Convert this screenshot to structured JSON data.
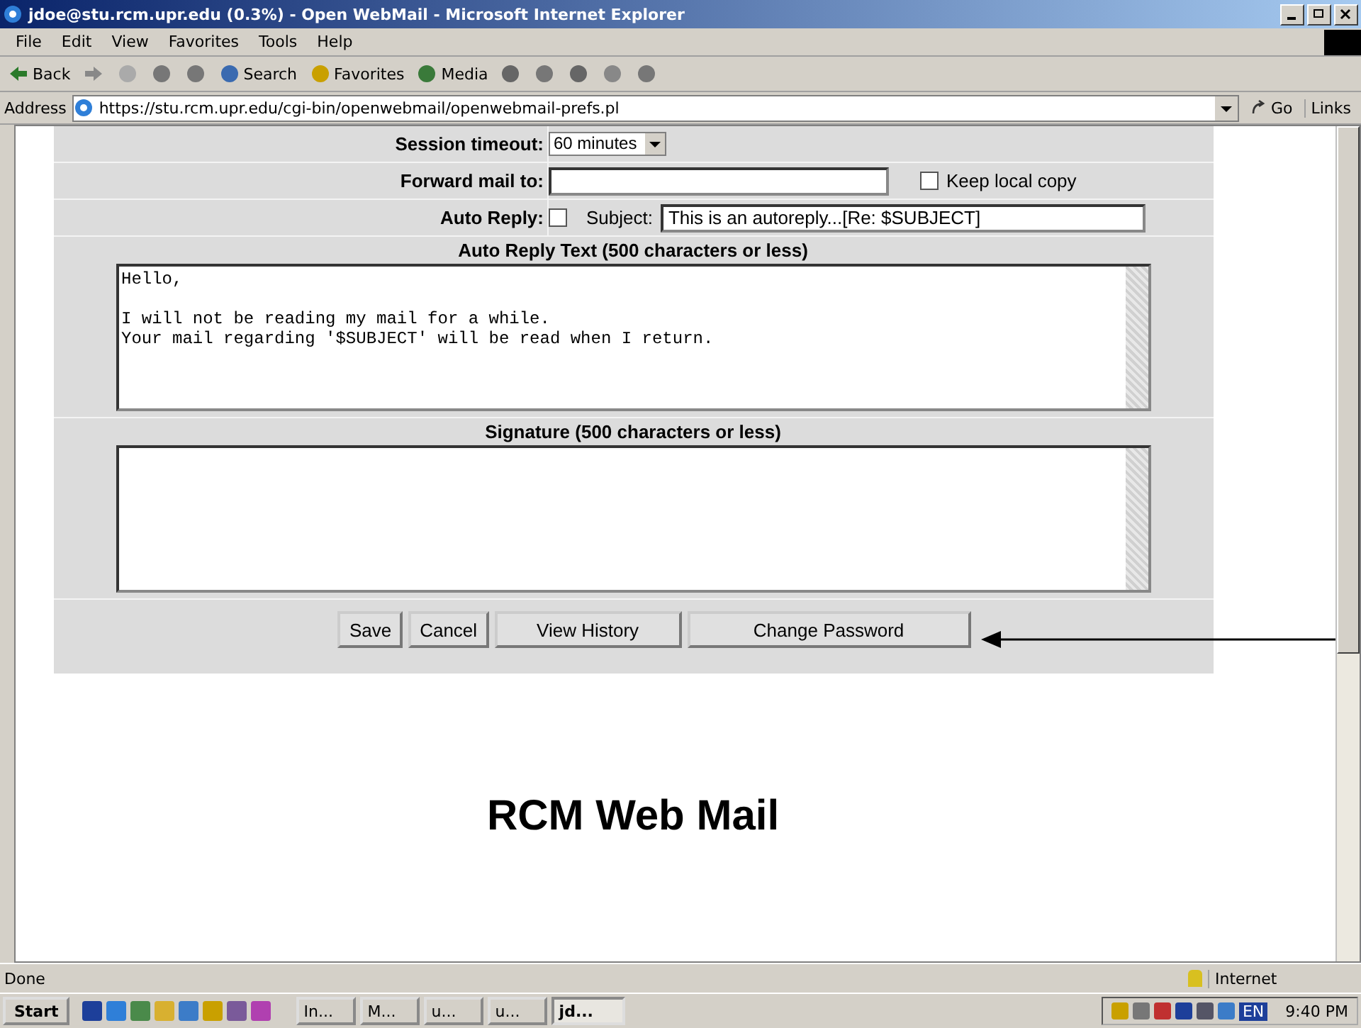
{
  "window": {
    "title": "jdoe@stu.rcm.upr.edu (0.3%) - Open WebMail - Microsoft Internet Explorer"
  },
  "menu": [
    "File",
    "Edit",
    "View",
    "Favorites",
    "Tools",
    "Help"
  ],
  "toolbar": [
    {
      "kind": "back",
      "label": "Back"
    },
    {
      "kind": "forward"
    },
    {
      "kind": "stop"
    },
    {
      "kind": "refresh"
    },
    {
      "kind": "home"
    },
    {
      "kind": "search",
      "label": "Search"
    },
    {
      "kind": "favorites",
      "label": "Favorites"
    },
    {
      "kind": "media",
      "label": "Media"
    },
    {
      "kind": "history"
    },
    {
      "kind": "mail"
    },
    {
      "kind": "print"
    },
    {
      "kind": "edit"
    },
    {
      "kind": "discuss"
    }
  ],
  "address": {
    "label": "Address",
    "value": "https://stu.rcm.upr.edu/cgi-bin/openwebmail/openwebmail-prefs.pl",
    "go": "Go",
    "links": "Links"
  },
  "prefs": {
    "session_label": "Session timeout:",
    "session_value": "60 minutes",
    "forward_label": "Forward mail to:",
    "keep_local_label": "Keep local copy",
    "keep_local_checked": false,
    "auto_reply_label": "Auto Reply:",
    "auto_reply_checked": false,
    "subject_label": "Subject:",
    "subject_value": "This is an autoreply...[Re: $SUBJECT]",
    "auto_reply_text_label": "Auto Reply Text (500 characters or less)",
    "auto_reply_text": "Hello,\n\nI will not be reading my mail for a while.\nYour mail regarding '$SUBJECT' will be read when I return.",
    "signature_label": "Signature (500 characters or less)"
  },
  "buttons": [
    "Save",
    "Cancel",
    "View History",
    "Change Password"
  ],
  "footer_title": "RCM Web Mail",
  "status_bar": {
    "text": "Done",
    "zone": "Internet"
  },
  "taskbar": {
    "start": "Start",
    "tasks": [
      {
        "label": "In...",
        "selected": false
      },
      {
        "label": "M...",
        "selected": false
      },
      {
        "label": "u...",
        "selected": false
      },
      {
        "label": "u...",
        "selected": false
      },
      {
        "label": "jd...",
        "selected": true
      }
    ],
    "language": "EN",
    "clock": "9:40 PM"
  }
}
